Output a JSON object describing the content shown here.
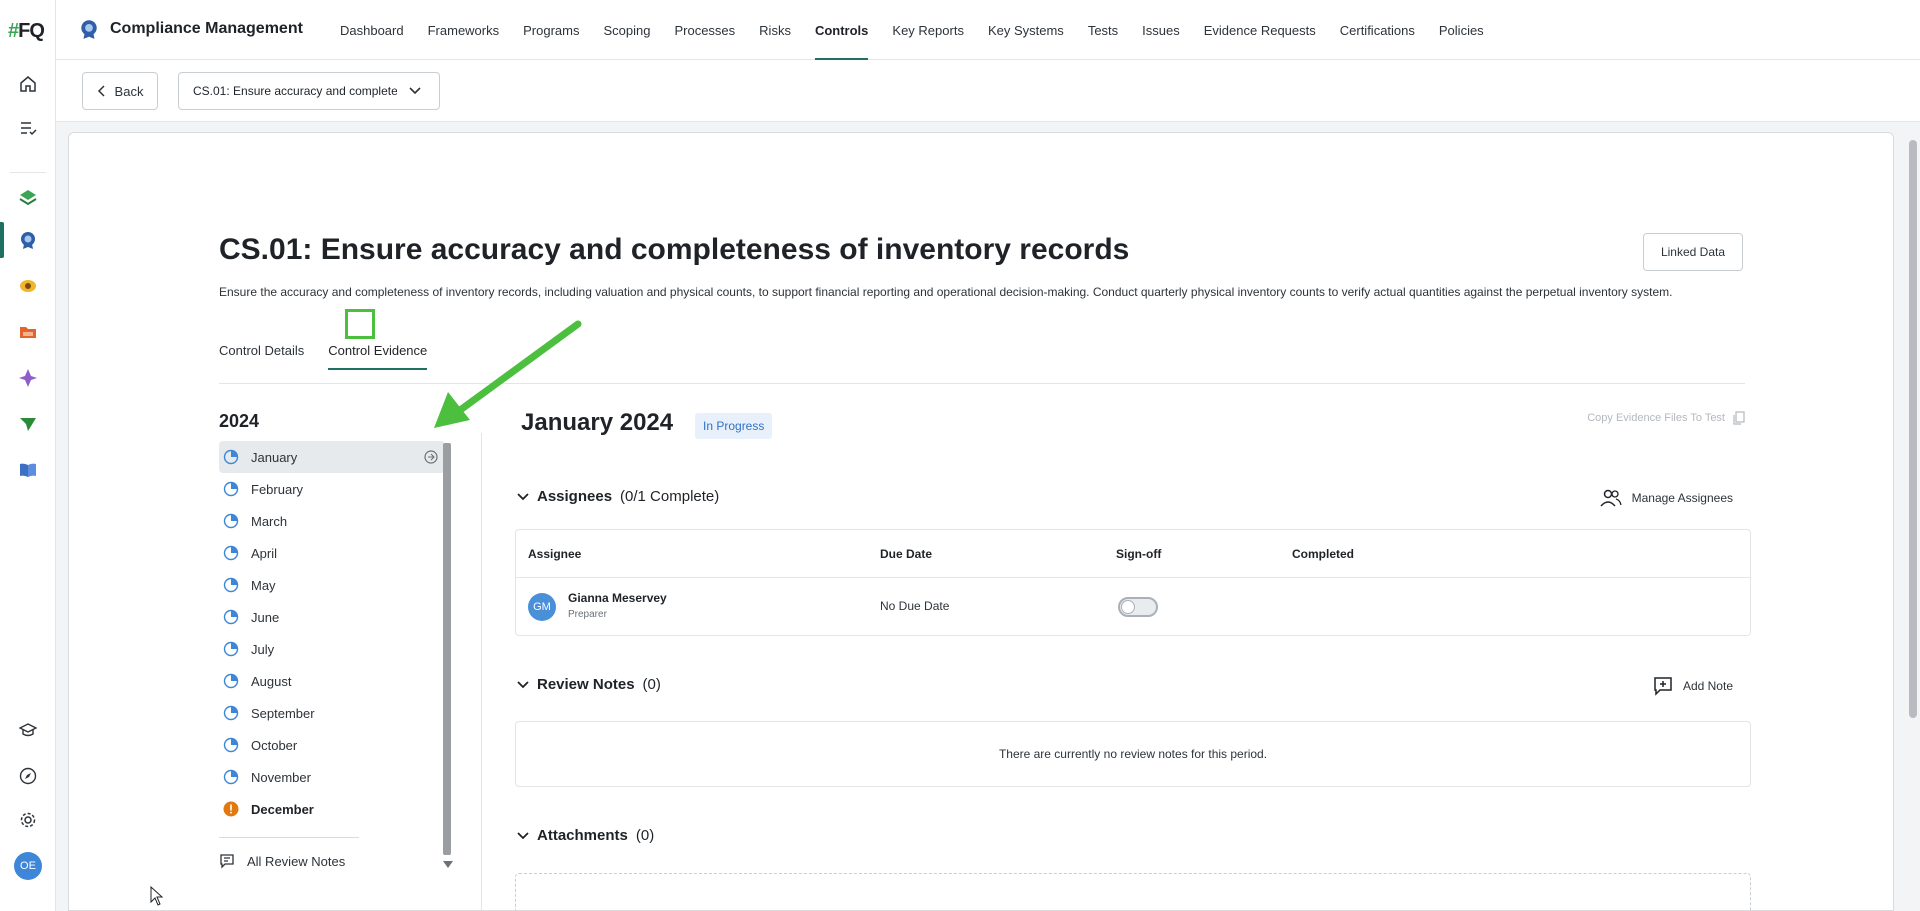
{
  "brand": {
    "logo_text": "FQ",
    "logo_hash": "#"
  },
  "app": {
    "title": "Compliance Management"
  },
  "nav": [
    {
      "label": "Dashboard"
    },
    {
      "label": "Frameworks"
    },
    {
      "label": "Programs"
    },
    {
      "label": "Scoping"
    },
    {
      "label": "Processes"
    },
    {
      "label": "Risks"
    },
    {
      "label": "Controls",
      "active": true
    },
    {
      "label": "Key Reports"
    },
    {
      "label": "Key Systems"
    },
    {
      "label": "Tests"
    },
    {
      "label": "Issues"
    },
    {
      "label": "Evidence Requests"
    },
    {
      "label": "Certifications"
    },
    {
      "label": "Policies"
    }
  ],
  "subbar": {
    "back_label": "Back",
    "control_select": "CS.01: Ensure accuracy and completeness of inventory records"
  },
  "user": {
    "initials": "OE"
  },
  "control": {
    "title": "CS.01: Ensure accuracy and completeness of inventory records",
    "description": "Ensure the accuracy and completeness of inventory records, including valuation and physical counts, to support financial reporting and operational decision-making. Conduct quarterly physical inventory counts to verify actual quantities against the perpetual inventory system.",
    "linked_data_label": "Linked Data"
  },
  "tabs": [
    {
      "label": "Control Details"
    },
    {
      "label": "Control Evidence",
      "active": true
    }
  ],
  "evidence": {
    "year": "2024",
    "months": [
      {
        "label": "January",
        "status": "in-progress",
        "selected": true
      },
      {
        "label": "February",
        "status": "in-progress"
      },
      {
        "label": "March",
        "status": "in-progress"
      },
      {
        "label": "April",
        "status": "in-progress"
      },
      {
        "label": "May",
        "status": "in-progress"
      },
      {
        "label": "June",
        "status": "in-progress"
      },
      {
        "label": "July",
        "status": "in-progress"
      },
      {
        "label": "August",
        "status": "in-progress"
      },
      {
        "label": "September",
        "status": "in-progress"
      },
      {
        "label": "October",
        "status": "in-progress"
      },
      {
        "label": "November",
        "status": "in-progress"
      },
      {
        "label": "December",
        "status": "alert"
      }
    ],
    "all_review_notes_label": "All Review Notes",
    "period_title": "January 2024",
    "period_status": "In Progress",
    "copy_label": "Copy Evidence Files To Test",
    "assignees": {
      "heading": "Assignees",
      "count_text": "(0/1 Complete)",
      "manage_label": "Manage Assignees",
      "columns": [
        "Assignee",
        "Due Date",
        "Sign-off",
        "Completed"
      ],
      "rows": [
        {
          "initials": "GM",
          "name": "Gianna Meservey",
          "role": "Preparer",
          "due_date": "No Due Date"
        }
      ]
    },
    "review_notes": {
      "heading": "Review Notes",
      "count_text": "(0)",
      "add_label": "Add Note",
      "empty_text": "There are currently no review notes for this period."
    },
    "attachments": {
      "heading": "Attachments",
      "count_text": "(0)"
    }
  },
  "colors": {
    "accent": "#1f6f62",
    "badge_blue": "#2f72c8",
    "alert_orange": "#e07a10",
    "highlight_green": "#4cbf3f"
  }
}
